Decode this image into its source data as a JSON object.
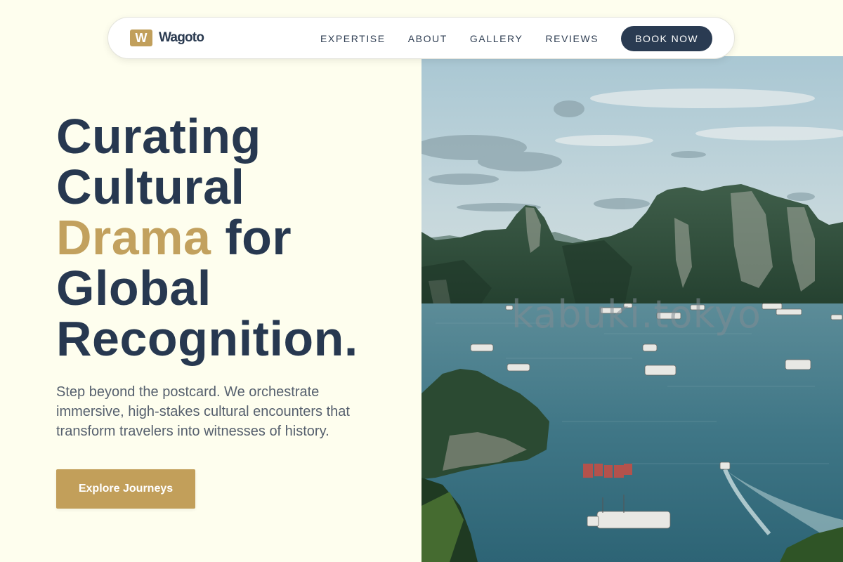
{
  "brand": {
    "mark": "W",
    "name": "Wagoto"
  },
  "nav": {
    "links": [
      {
        "label": "EXPERTISE"
      },
      {
        "label": "ABOUT"
      },
      {
        "label": "GALLERY"
      },
      {
        "label": "REVIEWS"
      }
    ],
    "cta_label": "BOOK NOW"
  },
  "hero": {
    "headline": {
      "line1": "Curating",
      "line2": "Cultural",
      "accent_word": "Drama",
      "line3_rest": " for",
      "line4": "Global",
      "line5": "Recognition."
    },
    "subtext": "Step beyond the postcard. We orchestrate immersive, high-stakes cultural encounters that transform travelers into witnesses of history.",
    "cta_label": "Explore Journeys",
    "image_watermark": "kabuki.tokyo"
  },
  "colors": {
    "background": "#fefeee",
    "primary_navy": "#2a3b52",
    "accent_gold": "#c19f5b",
    "body_text": "#56606e"
  },
  "icons": {
    "brand_logo": "letter-w-logo"
  }
}
